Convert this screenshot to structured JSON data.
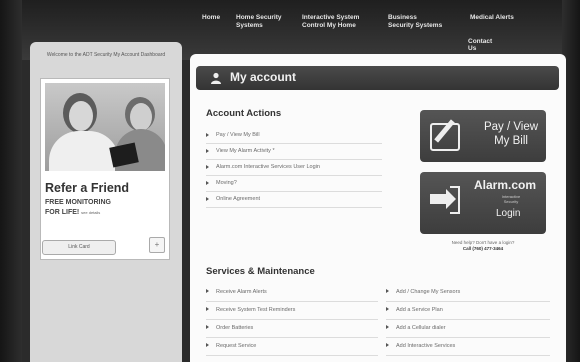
{
  "nav": {
    "items": [
      "Home",
      "Home Security Systems",
      "Interactive System Control My Home",
      "Business Security Systems",
      "Medical Alerts"
    ],
    "contact": "Contact Us"
  },
  "left": {
    "welcome": "Welcome to the ADT Security My Account Dashboard",
    "refer_title": "Refer a Friend",
    "free_line": "FREE MONITORING",
    "life_line": "FOR LIFE!",
    "life_small": "see details",
    "link_button": "Link Card"
  },
  "main": {
    "title": "My account",
    "account_actions_title": "Account Actions",
    "account_actions": [
      "Pay / View My Bill",
      "View My Alarm Activity *",
      "Alarm.com Interactive Services User Login",
      "Moving?",
      "Online Agreement"
    ],
    "pay_button": "Pay / View My Bill",
    "alarm_brand": "Alarm.com",
    "alarm_tagline": "Interactive Security",
    "alarm_login": "Login",
    "help_line1": "Need help? Don't have a login?",
    "help_line2": "Call (760) 477-3464",
    "services_title": "Services & Maintenance",
    "services_left": [
      "Receive Alarm Alerts",
      "Receive System Test Reminders",
      "Order Batteries",
      "Request Service"
    ],
    "services_right": [
      "Add / Change My Sensors",
      "Add a Service Plan",
      "Add a Cellular dialer",
      "Add Interactive Services"
    ]
  }
}
